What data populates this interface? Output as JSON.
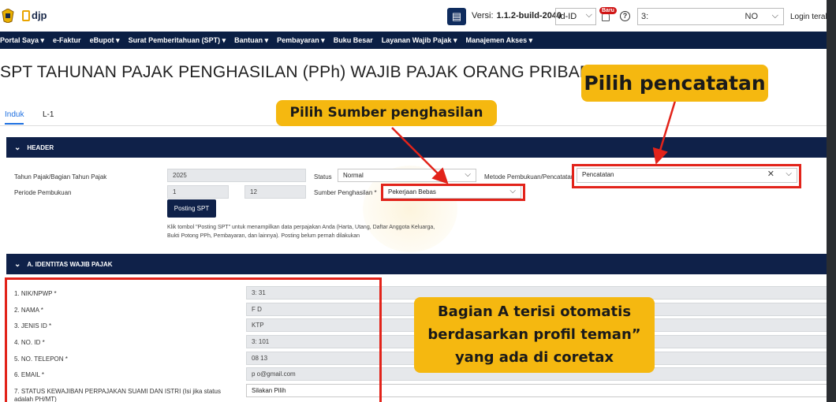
{
  "colors": {
    "navy": "#0f2149",
    "accent_blue": "#1d6fe0",
    "callout_yellow": "#f5b810",
    "highlight_red": "#e2231a",
    "badge_red": "#d01616"
  },
  "header": {
    "logo_text": "djp",
    "version_label": "Versi:",
    "version_value": "1.1.2-build-2040",
    "language": "id-ID",
    "badge": "Baru",
    "account_prefix": "3:",
    "account_suffix": "NO",
    "login_text": "Login terakh"
  },
  "nav": [
    "Portal Saya ▾",
    "e-Faktur",
    "eBupot ▾",
    "Surat Pemberitahuan (SPT) ▾",
    "Bantuan ▾",
    "Pembayaran ▾",
    "Buku Besar",
    "Layanan Wajib Pajak ▾",
    "Manajemen Akses ▾"
  ],
  "page_title": "SPT TAHUNAN PAJAK PENGHASILAN (PPh) WAJIB PAJAK ORANG PRIBADI",
  "tabs": [
    "Induk",
    "L-1"
  ],
  "header_section": {
    "title": "HEADER",
    "tahun_label": "Tahun Pajak/Bagian Tahun Pajak",
    "tahun_value": "2025",
    "periode_label": "Periode Pembukuan",
    "periode_from": "1",
    "periode_to": "12",
    "status_label": "Status",
    "status_value": "Normal",
    "sumber_label": "Sumber Penghasilan *",
    "sumber_value": "Pekerjaan Bebas",
    "metode_label": "Metode Pembukuan/Pencatatan",
    "metode_value": "Pencatatan",
    "posting_button": "Posting SPT",
    "note": "Klik tombol \"Posting SPT\" untuk menampilkan data perpajakan Anda (Harta, Utang, Daftar Anggota Keluarga, Bukti Potong PPh, Pembayaran, dan lainnya). Posting belum pernah dilakukan"
  },
  "identity_section": {
    "title": "A. IDENTITAS WAJIB PAJAK",
    "rows": [
      {
        "label": "1. NIK/NPWP *",
        "value": "3:            31"
      },
      {
        "label": "2. NAMA *",
        "value": "F            D"
      },
      {
        "label": "3. JENIS ID *",
        "value": "KTP"
      },
      {
        "label": "4. NO. ID *",
        "value": "3:            101"
      },
      {
        "label": "5. NO. TELEPON *",
        "value": "08            13"
      },
      {
        "label": "6. EMAIL *",
        "value": "p                o@gmail.com"
      },
      {
        "label": "7. STATUS KEWAJIBAN PERPAJAKAN SUAMI DAN ISTRI (Isi jika status adalah PH/MT)",
        "value": "Silakan Pilih"
      }
    ]
  },
  "callouts": {
    "sumber": "Pilih Sumber penghasilan",
    "pencatatan": "Pilih pencatatan",
    "bagian_a_line1": "Bagian A terisi otomatis",
    "bagian_a_line2": "berdasarkan profil teman”",
    "bagian_a_line3": "yang ada di coretax"
  }
}
